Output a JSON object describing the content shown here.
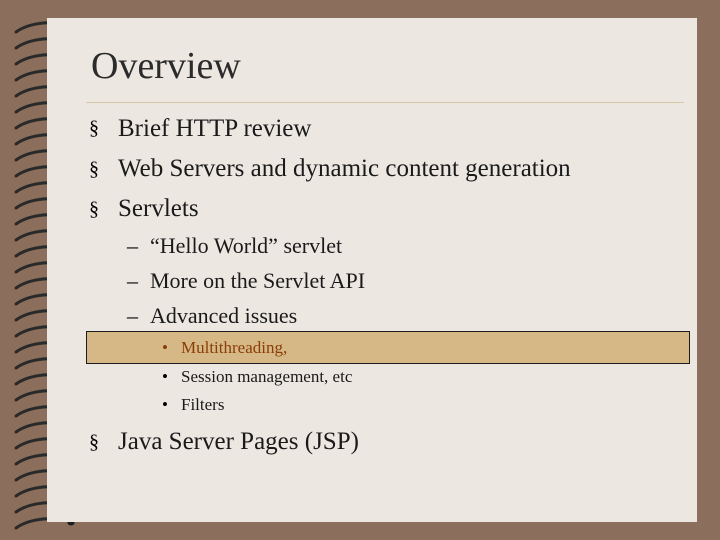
{
  "slide": {
    "title": "Overview",
    "bullet_marker": "§",
    "dash_marker": "–",
    "dot_marker": "•",
    "items": [
      {
        "text": "Brief HTTP review"
      },
      {
        "text": "Web Servers and dynamic content generation"
      },
      {
        "text": "Servlets"
      },
      {
        "text": "“Hello World” servlet"
      },
      {
        "text": "More on the Servlet API"
      },
      {
        "text": "Advanced issues"
      },
      {
        "text": "Multithreading,"
      },
      {
        "text": "Session management, etc"
      },
      {
        "text": "Filters"
      },
      {
        "text": "Java Server Pages (JSP)"
      }
    ]
  },
  "colors": {
    "background": "#8b6f5c",
    "page": "#ede7e2",
    "highlight": "#d6b886",
    "highlight_text": "#8a3d06"
  }
}
